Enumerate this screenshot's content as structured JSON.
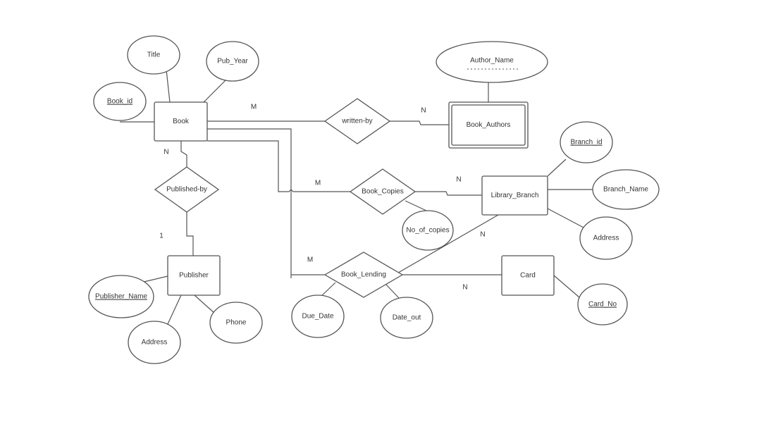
{
  "diagram": {
    "entities": [
      {
        "id": "book",
        "label": "Book"
      },
      {
        "id": "book_authors",
        "label": "Book_Authors",
        "weak": true
      },
      {
        "id": "library_branch",
        "label": "Library_Branch"
      },
      {
        "id": "publisher",
        "label": "Publisher"
      },
      {
        "id": "card",
        "label": "Card"
      }
    ],
    "relationships": [
      {
        "id": "written_by",
        "label": "written-by"
      },
      {
        "id": "book_copies",
        "label": "Book_Copies"
      },
      {
        "id": "published_by",
        "label": "Published-by"
      },
      {
        "id": "book_lending",
        "label": "Book_Lending"
      }
    ],
    "attributes": [
      {
        "id": "title",
        "label": "Title",
        "key": false
      },
      {
        "id": "pub_year",
        "label": "Pub_Year",
        "key": false
      },
      {
        "id": "book_id",
        "label": "Book_id",
        "key": true
      },
      {
        "id": "author_name",
        "label": "Author_Name",
        "partial_key": true
      },
      {
        "id": "branch_id",
        "label": "Branch_id",
        "key": true
      },
      {
        "id": "branch_name",
        "label": "Branch_Name",
        "key": false
      },
      {
        "id": "branch_address",
        "label": "Address",
        "key": false
      },
      {
        "id": "no_of_copies",
        "label": "No_of_copies",
        "key": false
      },
      {
        "id": "publisher_name",
        "label": "Publisher_Name",
        "key": true
      },
      {
        "id": "phone",
        "label": "Phone",
        "key": false
      },
      {
        "id": "publisher_address",
        "label": "Address",
        "key": false
      },
      {
        "id": "card_no",
        "label": "Card_No",
        "key": true
      },
      {
        "id": "due_date",
        "label": "Due_Date",
        "key": false
      },
      {
        "id": "date_out",
        "label": "Date_out",
        "key": false
      }
    ],
    "cardinalities": [
      {
        "id": "c1",
        "label": "M"
      },
      {
        "id": "c2",
        "label": "N"
      },
      {
        "id": "c3",
        "label": "N"
      },
      {
        "id": "c4",
        "label": "1"
      },
      {
        "id": "c5",
        "label": "M"
      },
      {
        "id": "c6",
        "label": "N"
      },
      {
        "id": "c7",
        "label": "N"
      },
      {
        "id": "c8",
        "label": "M"
      },
      {
        "id": "c9",
        "label": "N"
      }
    ]
  }
}
